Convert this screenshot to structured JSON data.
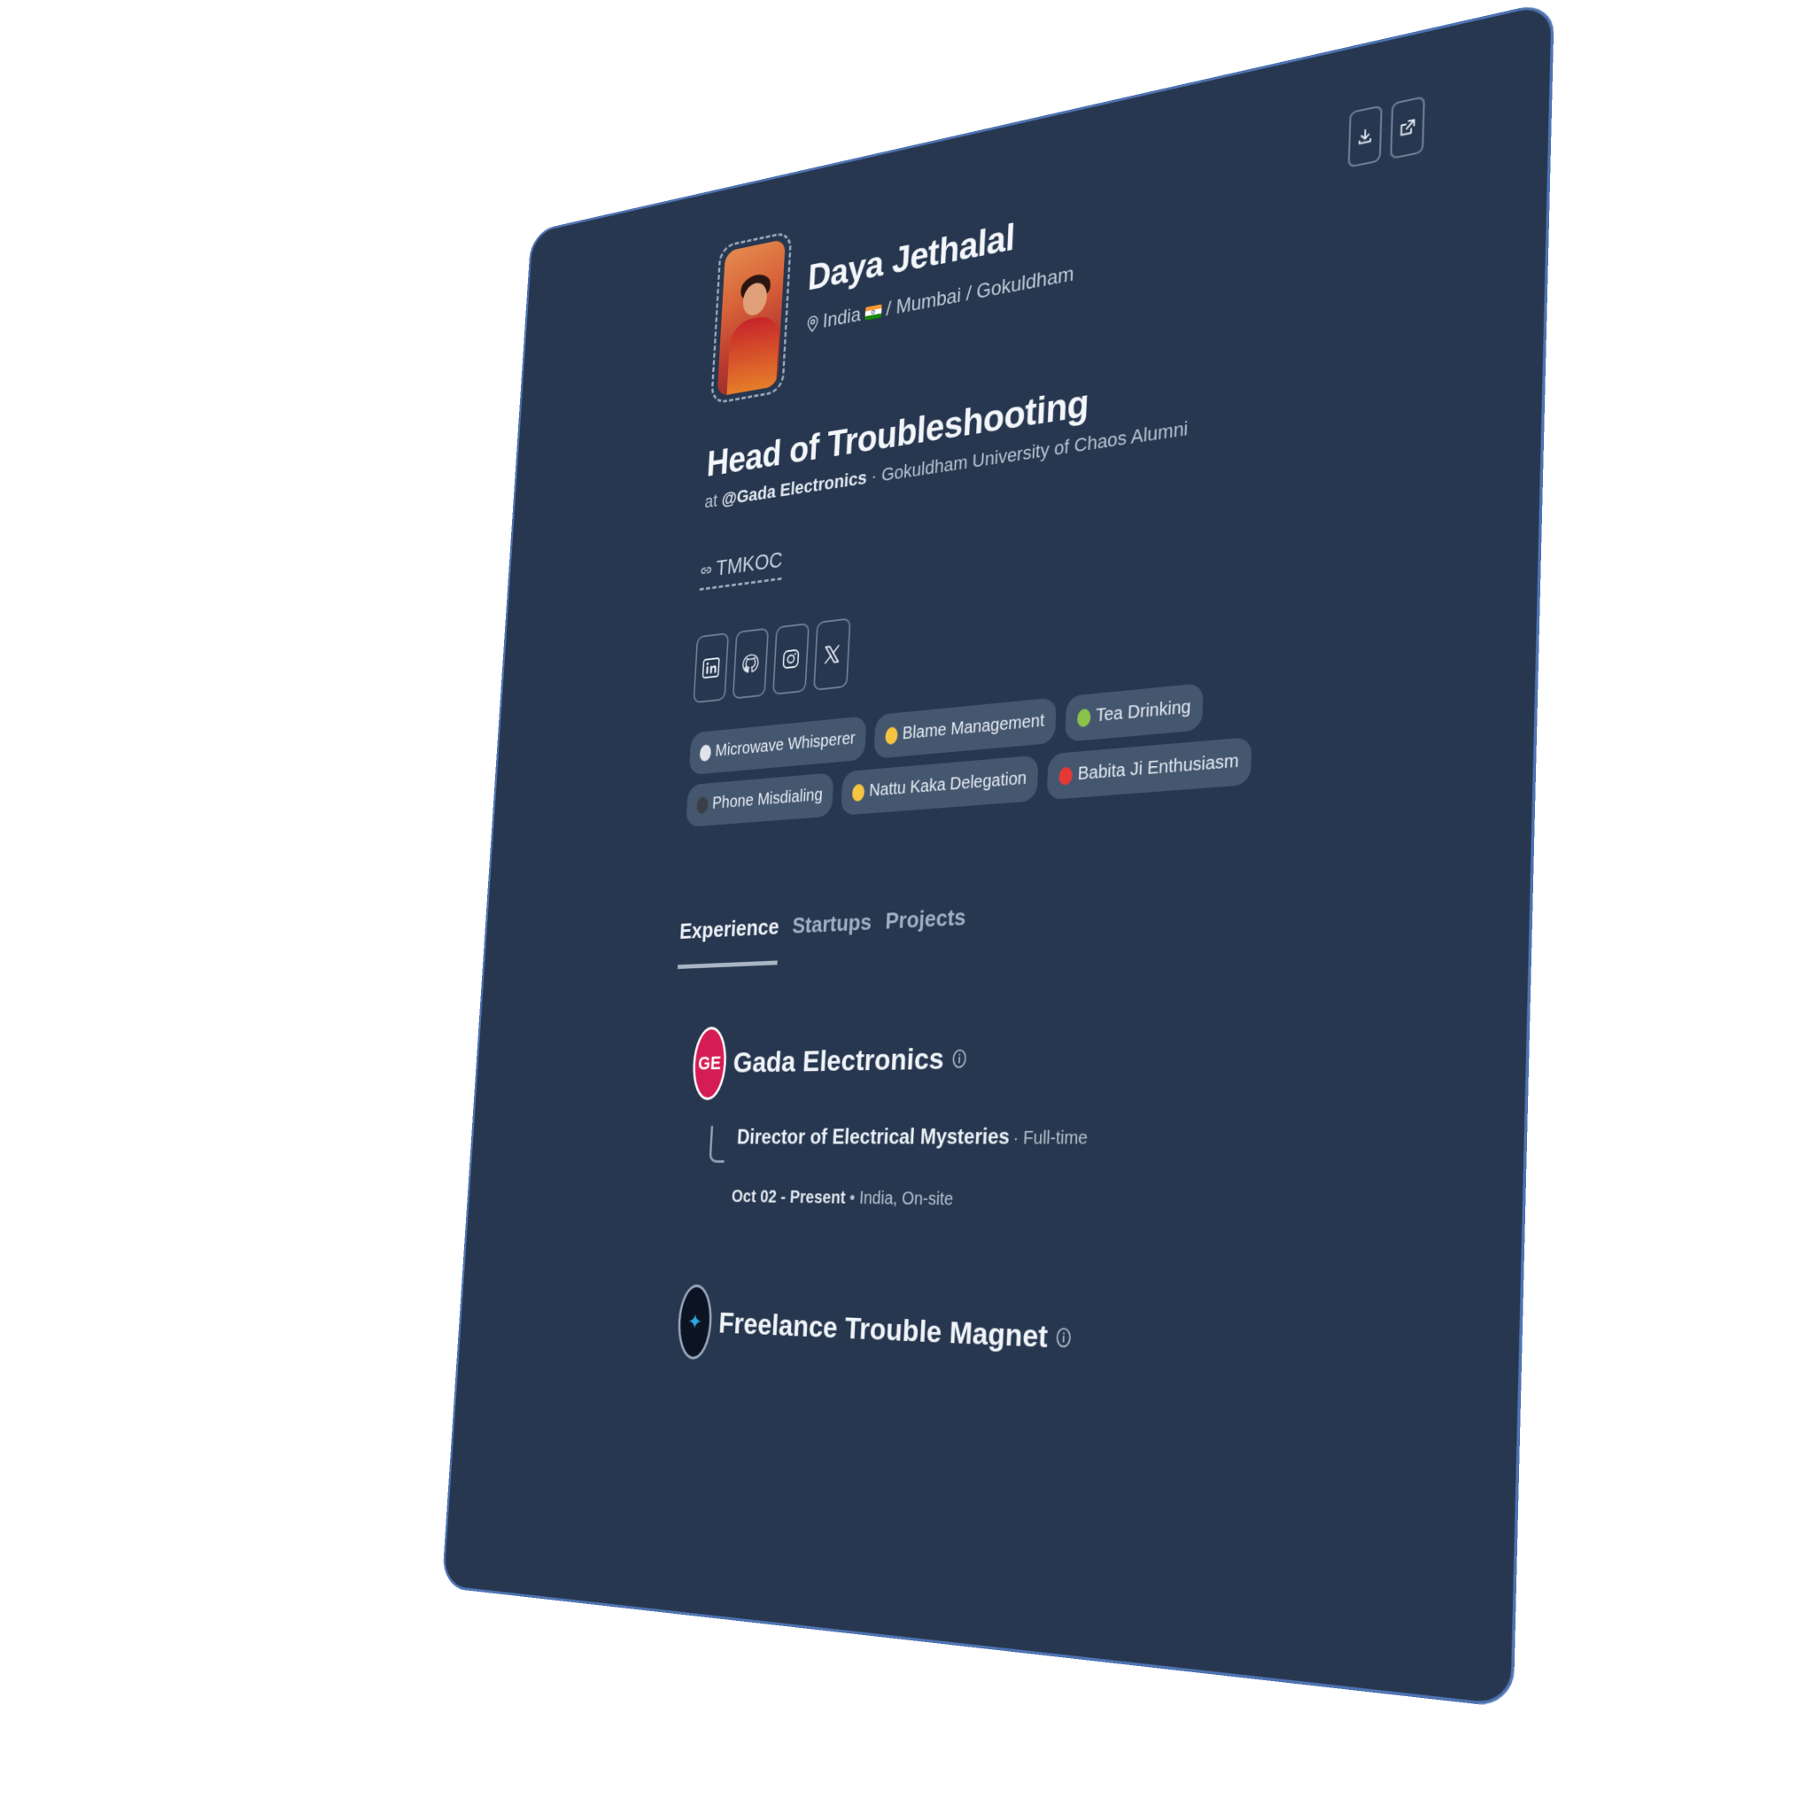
{
  "profile": {
    "name": "Daya Jethalal",
    "location": {
      "country": "India",
      "rest": "/ Mumbai / Gokuldham"
    },
    "title": "Head of Troubleshooting",
    "subtitle_prefix": "at",
    "company_handle": "@Gada Electronics",
    "subtitle_rest": "· Gokuldham University of Chaos Alumni",
    "link_label": "TMKOC"
  },
  "top_actions": [
    "download-icon",
    "external-link-icon"
  ],
  "socials": [
    "linkedin-icon",
    "github-icon",
    "instagram-icon",
    "x-icon"
  ],
  "chips": [
    {
      "label": "Microwave Whisperer",
      "emoji_color": "#dfe3ea"
    },
    {
      "label": "Blame Management",
      "emoji_color": "#f5c542"
    },
    {
      "label": "Tea Drinking",
      "emoji_color": "#8bc34a"
    },
    {
      "label": "Phone Misdialing",
      "emoji_color": "#3a3f47"
    },
    {
      "label": "Nattu Kaka Delegation",
      "emoji_color": "#f5c542"
    },
    {
      "label": "Babita Ji Enthusiasm",
      "emoji_color": "#e53935"
    }
  ],
  "tabs": [
    {
      "label": "Experience",
      "active": true
    },
    {
      "label": "Startups",
      "active": false
    },
    {
      "label": "Projects",
      "active": false
    }
  ],
  "experience": [
    {
      "logo_text": "GE",
      "company": "Gada Electronics",
      "role": "Director of Electrical Mysteries",
      "type": "· Full-time",
      "dates": "Oct 02 - Present",
      "place": "• India, On-site"
    },
    {
      "logo_text": "✦",
      "company": "Freelance Trouble Magnet"
    }
  ],
  "colors": {
    "card_bg": "#27374f",
    "card_border": "#4f74b3",
    "chip_bg": "#45576f",
    "accent_logo": "#d51c54"
  }
}
